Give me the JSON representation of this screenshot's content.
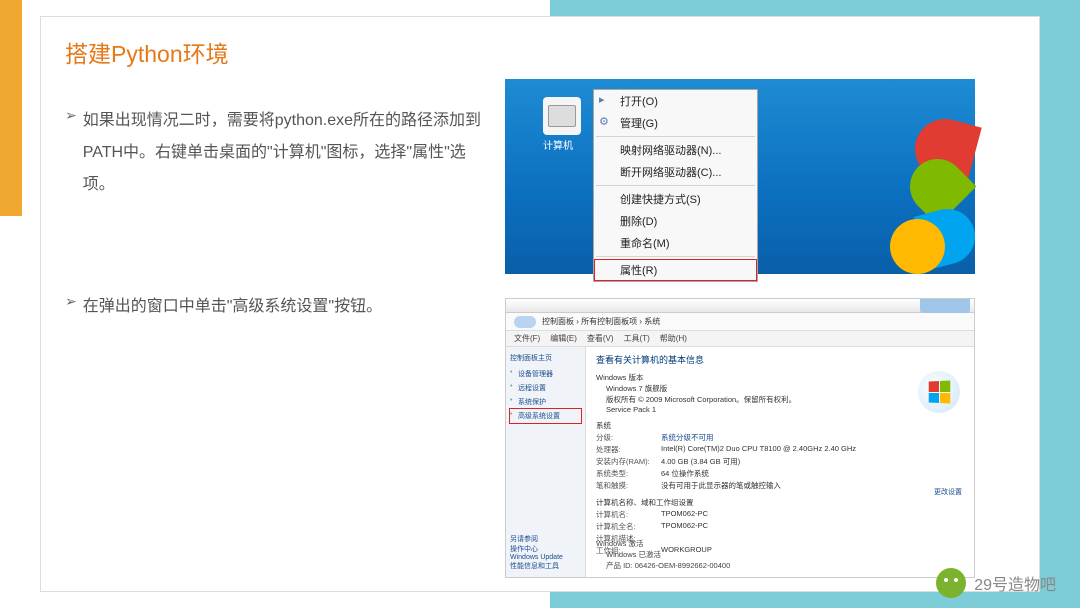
{
  "slide": {
    "title": "搭建Python环境",
    "bullets": [
      "如果出现情况二时，需要将python.exe所在的路径添加到PATH中。右键单击桌面的\"计算机\"图标，选择\"属性\"选项。",
      "在弹出的窗口中单击\"高级系统设置\"按钮。"
    ]
  },
  "shot1": {
    "icon_label": "计算机",
    "menu": [
      {
        "label": "打开(O)"
      },
      {
        "label": "管理(G)"
      },
      {
        "sep": true
      },
      {
        "label": "映射网络驱动器(N)..."
      },
      {
        "label": "断开网络驱动器(C)..."
      },
      {
        "sep": true
      },
      {
        "label": "创建快捷方式(S)"
      },
      {
        "label": "删除(D)"
      },
      {
        "label": "重命名(M)"
      },
      {
        "sep": true
      },
      {
        "label": "属性(R)",
        "boxed": true
      }
    ]
  },
  "shot2": {
    "addr_path": "控制面板 › 所有控制面板项 › 系统",
    "menubar": [
      "文件(F)",
      "编辑(E)",
      "查看(V)",
      "工具(T)",
      "帮助(H)"
    ],
    "side_title": "控制面板主页",
    "side_links": [
      {
        "label": "设备管理器"
      },
      {
        "label": "远程设置"
      },
      {
        "label": "系统保护"
      },
      {
        "label": "高级系统设置",
        "boxed": true
      }
    ],
    "side_bottom": [
      "另请参阅",
      "操作中心",
      "Windows Update",
      "性能信息和工具"
    ],
    "main_title": "查看有关计算机的基本信息",
    "win_edition_h": "Windows 版本",
    "win_edition_1": "Windows 7 旗舰版",
    "win_edition_2": "版权所有 © 2009 Microsoft Corporation。保留所有权利。",
    "win_edition_3": "Service Pack 1",
    "sys_h": "系统",
    "sys_rows": [
      {
        "k": "分级:",
        "v": "系统分级不可用"
      },
      {
        "k": "处理器:",
        "v": "Intel(R) Core(TM)2 Duo CPU   T8100 @ 2.40GHz  2.40 GHz"
      },
      {
        "k": "安装内存(RAM):",
        "v": "4.00 GB (3.84 GB 可用)"
      },
      {
        "k": "系统类型:",
        "v": "64 位操作系统"
      },
      {
        "k": "笔和触摸:",
        "v": "没有可用于此显示器的笔或触控输入"
      }
    ],
    "net_h": "计算机名称、域和工作组设置",
    "net_rows": [
      {
        "k": "计算机名:",
        "v": "TPOM062-PC"
      },
      {
        "k": "计算机全名:",
        "v": "TPOM062-PC"
      },
      {
        "k": "计算机描述:",
        "v": ""
      },
      {
        "k": "工作组:",
        "v": "WORKGROUP"
      }
    ],
    "change_link": "更改设置",
    "act_h": "Windows 激活",
    "act_1": "Windows 已激活",
    "act_2": "产品 ID: 06426-OEM-8992662-00400"
  },
  "footer": {
    "brand": "29号造物吧"
  }
}
